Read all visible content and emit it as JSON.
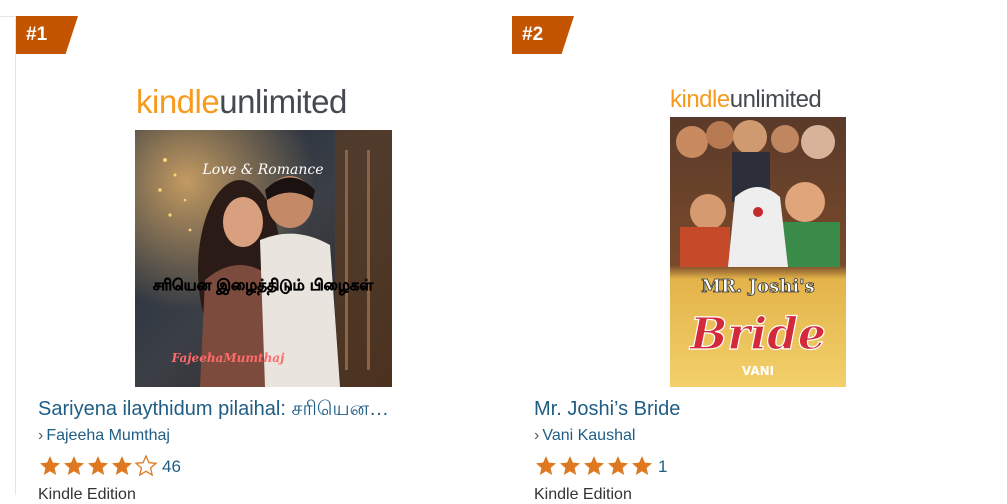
{
  "items": [
    {
      "rank": "#1",
      "ku_kindle": "kindle",
      "ku_unlimited": "unlimited",
      "cover": {
        "top_text": "Love & Romance",
        "title_text": "சரியென இழைத்திடும் பிழைகள்",
        "author_text": "FajeehaMumthaj"
      },
      "title": "Sariyena ilaythidum pilaihal: சரியென…",
      "author": "Fajeeha Mumthaj",
      "rating": 4,
      "rating_count": "46",
      "format": "Kindle Edition"
    },
    {
      "rank": "#2",
      "ku_kindle": "kindle",
      "ku_unlimited": "unlimited",
      "cover": {
        "title_mr": "MR. Joshi's",
        "title_bride": "Bride",
        "author_text": "VANI"
      },
      "title": "Mr. Joshi’s Bride",
      "author": "Vani Kaushal",
      "rating": 5,
      "rating_count": "1",
      "format": "Kindle Edition"
    }
  ],
  "colors": {
    "rank_badge": "#c45500",
    "link": "#1f5d84",
    "star": "#de7921",
    "ku_orange": "#f79a1e",
    "ku_gray": "#444a4f"
  },
  "icons": {
    "chevron": "›"
  }
}
